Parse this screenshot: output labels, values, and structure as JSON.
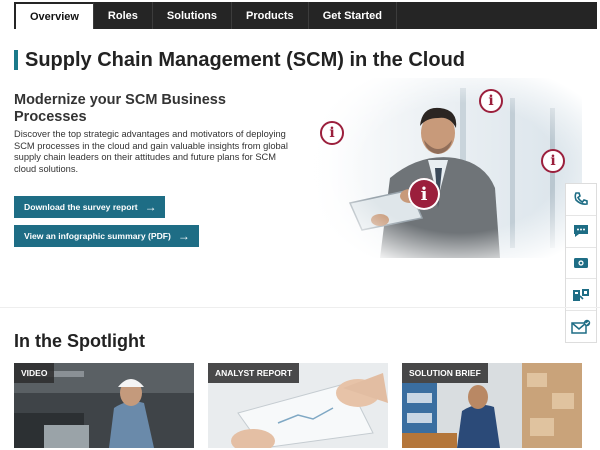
{
  "nav": {
    "tabs": [
      {
        "label": "Overview",
        "active": true
      },
      {
        "label": "Roles"
      },
      {
        "label": "Solutions"
      },
      {
        "label": "Products"
      },
      {
        "label": "Get Started"
      }
    ]
  },
  "page": {
    "title": "Supply Chain Management (SCM) in the Cloud"
  },
  "hero": {
    "heading": "Modernize your SCM Business Processes",
    "body": "Discover the top strategic advantages and motivators of deploying SCM processes in the cloud and gain valuable insights from global supply chain leaders on their attitudes and future plans for SCM cloud solutions.",
    "buttons": {
      "survey": "Download the survey report",
      "infographic": "View an infographic summary (PDF)"
    },
    "info_glyph": "i"
  },
  "side_tools": [
    "phone-icon",
    "chat-icon",
    "camera-icon",
    "share-icon",
    "email-icon"
  ],
  "spotlight": {
    "title": "In the Spotlight",
    "cards": [
      {
        "label": "VIDEO"
      },
      {
        "label": "ANALYST REPORT"
      },
      {
        "label": "SOLUTION BRIEF"
      }
    ]
  },
  "colors": {
    "accent": "#1e6d85",
    "title_bar": "#1a7a8a",
    "info_badge": "#9b1f3c",
    "nav_bg": "#252525"
  }
}
